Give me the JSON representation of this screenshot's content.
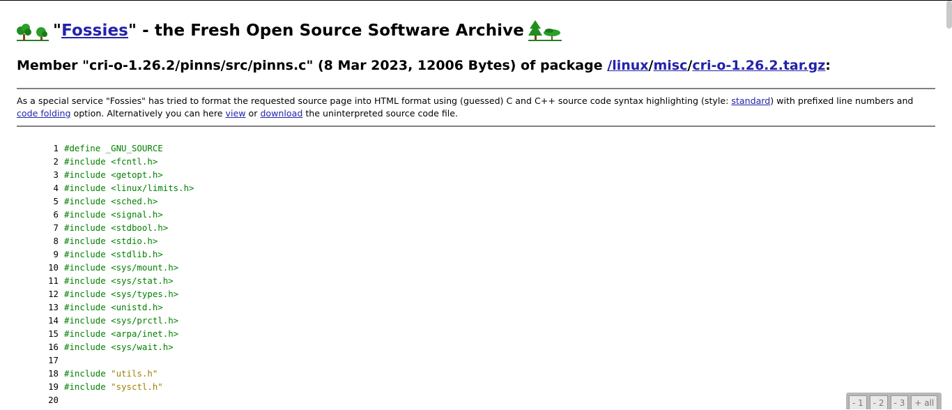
{
  "header": {
    "quote_open": "\"",
    "site_link": "Fossies",
    "title_rest": "\" - the Fresh Open Source Software Archive"
  },
  "member": {
    "prefix": "Member \"cri-o-1.26.2/pinns/src/pinns.c\" (8 Mar 2023, 12006 Bytes) of package ",
    "path_linux": "/linux",
    "slash1": "/",
    "path_misc": "misc",
    "slash2": "/",
    "path_pkg": "cri-o-1.26.2.tar.gz",
    "suffix": ":"
  },
  "notice": {
    "t1": "As a special service \"Fossies\" has tried to format the requested source page into HTML format using (guessed) C and C++ source code syntax highlighting (style: ",
    "link_standard": "standard",
    "t2": ") with prefixed line numbers and ",
    "link_folding": "code folding",
    "t3": " option. Alternatively you can here ",
    "link_view": "view",
    "t4": " or ",
    "link_download": "download",
    "t5": " the uninterpreted source code file."
  },
  "code": [
    {
      "n": "1",
      "pp": "#define _GNU_SOURCE",
      "str": ""
    },
    {
      "n": "2",
      "pp": "#include <fcntl.h>",
      "str": ""
    },
    {
      "n": "3",
      "pp": "#include <getopt.h>",
      "str": ""
    },
    {
      "n": "4",
      "pp": "#include <linux/limits.h>",
      "str": ""
    },
    {
      "n": "5",
      "pp": "#include <sched.h>",
      "str": ""
    },
    {
      "n": "6",
      "pp": "#include <signal.h>",
      "str": ""
    },
    {
      "n": "7",
      "pp": "#include <stdbool.h>",
      "str": ""
    },
    {
      "n": "8",
      "pp": "#include <stdio.h>",
      "str": ""
    },
    {
      "n": "9",
      "pp": "#include <stdlib.h>",
      "str": ""
    },
    {
      "n": "10",
      "pp": "#include <sys/mount.h>",
      "str": ""
    },
    {
      "n": "11",
      "pp": "#include <sys/stat.h>",
      "str": ""
    },
    {
      "n": "12",
      "pp": "#include <sys/types.h>",
      "str": ""
    },
    {
      "n": "13",
      "pp": "#include <unistd.h>",
      "str": ""
    },
    {
      "n": "14",
      "pp": "#include <sys/prctl.h>",
      "str": ""
    },
    {
      "n": "15",
      "pp": "#include <arpa/inet.h>",
      "str": ""
    },
    {
      "n": "16",
      "pp": "#include <sys/wait.h>",
      "str": ""
    },
    {
      "n": "17",
      "pp": "",
      "str": ""
    },
    {
      "n": "18",
      "pp": "#include ",
      "str": "\"utils.h\""
    },
    {
      "n": "19",
      "pp": "#include ",
      "str": "\"sysctl.h\""
    },
    {
      "n": "20",
      "pp": "",
      "str": ""
    }
  ],
  "fold": [
    "- 1",
    "- 2",
    "- 3",
    "+ all"
  ],
  "colors": {
    "link": "#2222aa",
    "preprocessor": "#008000",
    "string": "#a08000",
    "rule": "#808080"
  },
  "icons": [
    "trees-left-icon",
    "trees-right-icon"
  ]
}
